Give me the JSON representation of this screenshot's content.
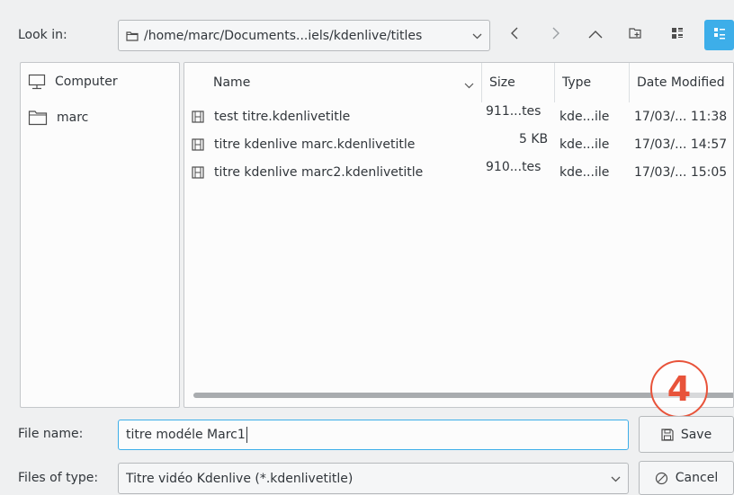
{
  "look_in": {
    "label": "Look in:",
    "path": "/home/marc/Documents...iels/kdenlive/titles"
  },
  "toolbar": {
    "icons": [
      "chevron-left-icon",
      "chevron-right-icon",
      "chevron-up-icon",
      "new-folder-icon",
      "icon-view-icon",
      "detail-view-icon"
    ]
  },
  "places": [
    {
      "label": "Computer",
      "icon": "computer-icon"
    },
    {
      "label": "marc",
      "icon": "folder-icon"
    }
  ],
  "columns": [
    "Name",
    "Size",
    "Type",
    "Date Modified"
  ],
  "files": [
    {
      "name": "test titre.kdenlivetitle",
      "size": "911...tes",
      "type": "kde...ile",
      "date": "17/03/... 11:38"
    },
    {
      "name": "titre kdenlive marc.kdenlivetitle",
      "size": "5 KB",
      "type": "kde...ile",
      "date": "17/03/... 14:57"
    },
    {
      "name": "titre kdenlive marc2.kdenlivetitle",
      "size": "910...tes",
      "type": "kde...ile",
      "date": "17/03/... 15:05"
    }
  ],
  "file_name": {
    "label": "File name:",
    "value": "titre modéle Marc1"
  },
  "file_type": {
    "label": "Files of type:",
    "value": "Titre vidéo Kdenlive (*.kdenlivetitle)"
  },
  "buttons": {
    "save": "Save",
    "cancel": "Cancel"
  },
  "annotation": {
    "step": "4",
    "color": "#e8533a"
  },
  "colors": {
    "accent": "#3daee9",
    "window": "#eff0f1"
  }
}
